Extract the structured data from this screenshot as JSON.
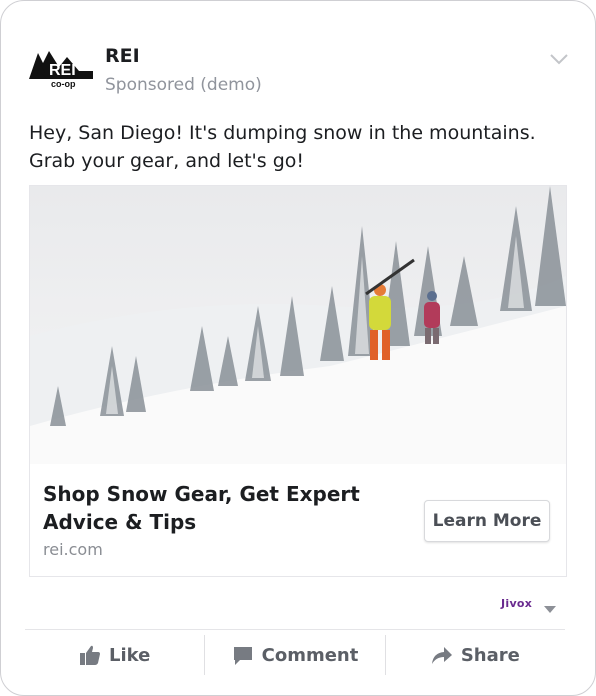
{
  "post": {
    "brand": "REI",
    "sponsored": "Sponsored (demo)",
    "message": "Hey, San Diego! It's dumping snow in the mountains. Grab your gear, and let's go!",
    "logo_text_top": "REI",
    "logo_text_bottom": "co-op"
  },
  "ad": {
    "headline": "Shop Snow Gear, Get Expert Advice & Tips",
    "domain": "rei.com",
    "cta": "Learn More"
  },
  "ad_network": {
    "label": "Jivox"
  },
  "actions": {
    "like": "Like",
    "comment": "Comment",
    "share": "Share"
  },
  "icons": {
    "menu": "chevron-down-icon",
    "like": "thumbs-up-icon",
    "comment": "speech-bubble-icon",
    "share": "share-arrow-icon"
  },
  "colors": {
    "text": "#1c1e21",
    "muted": "#90949c",
    "jivox": "#6a2b8f"
  }
}
